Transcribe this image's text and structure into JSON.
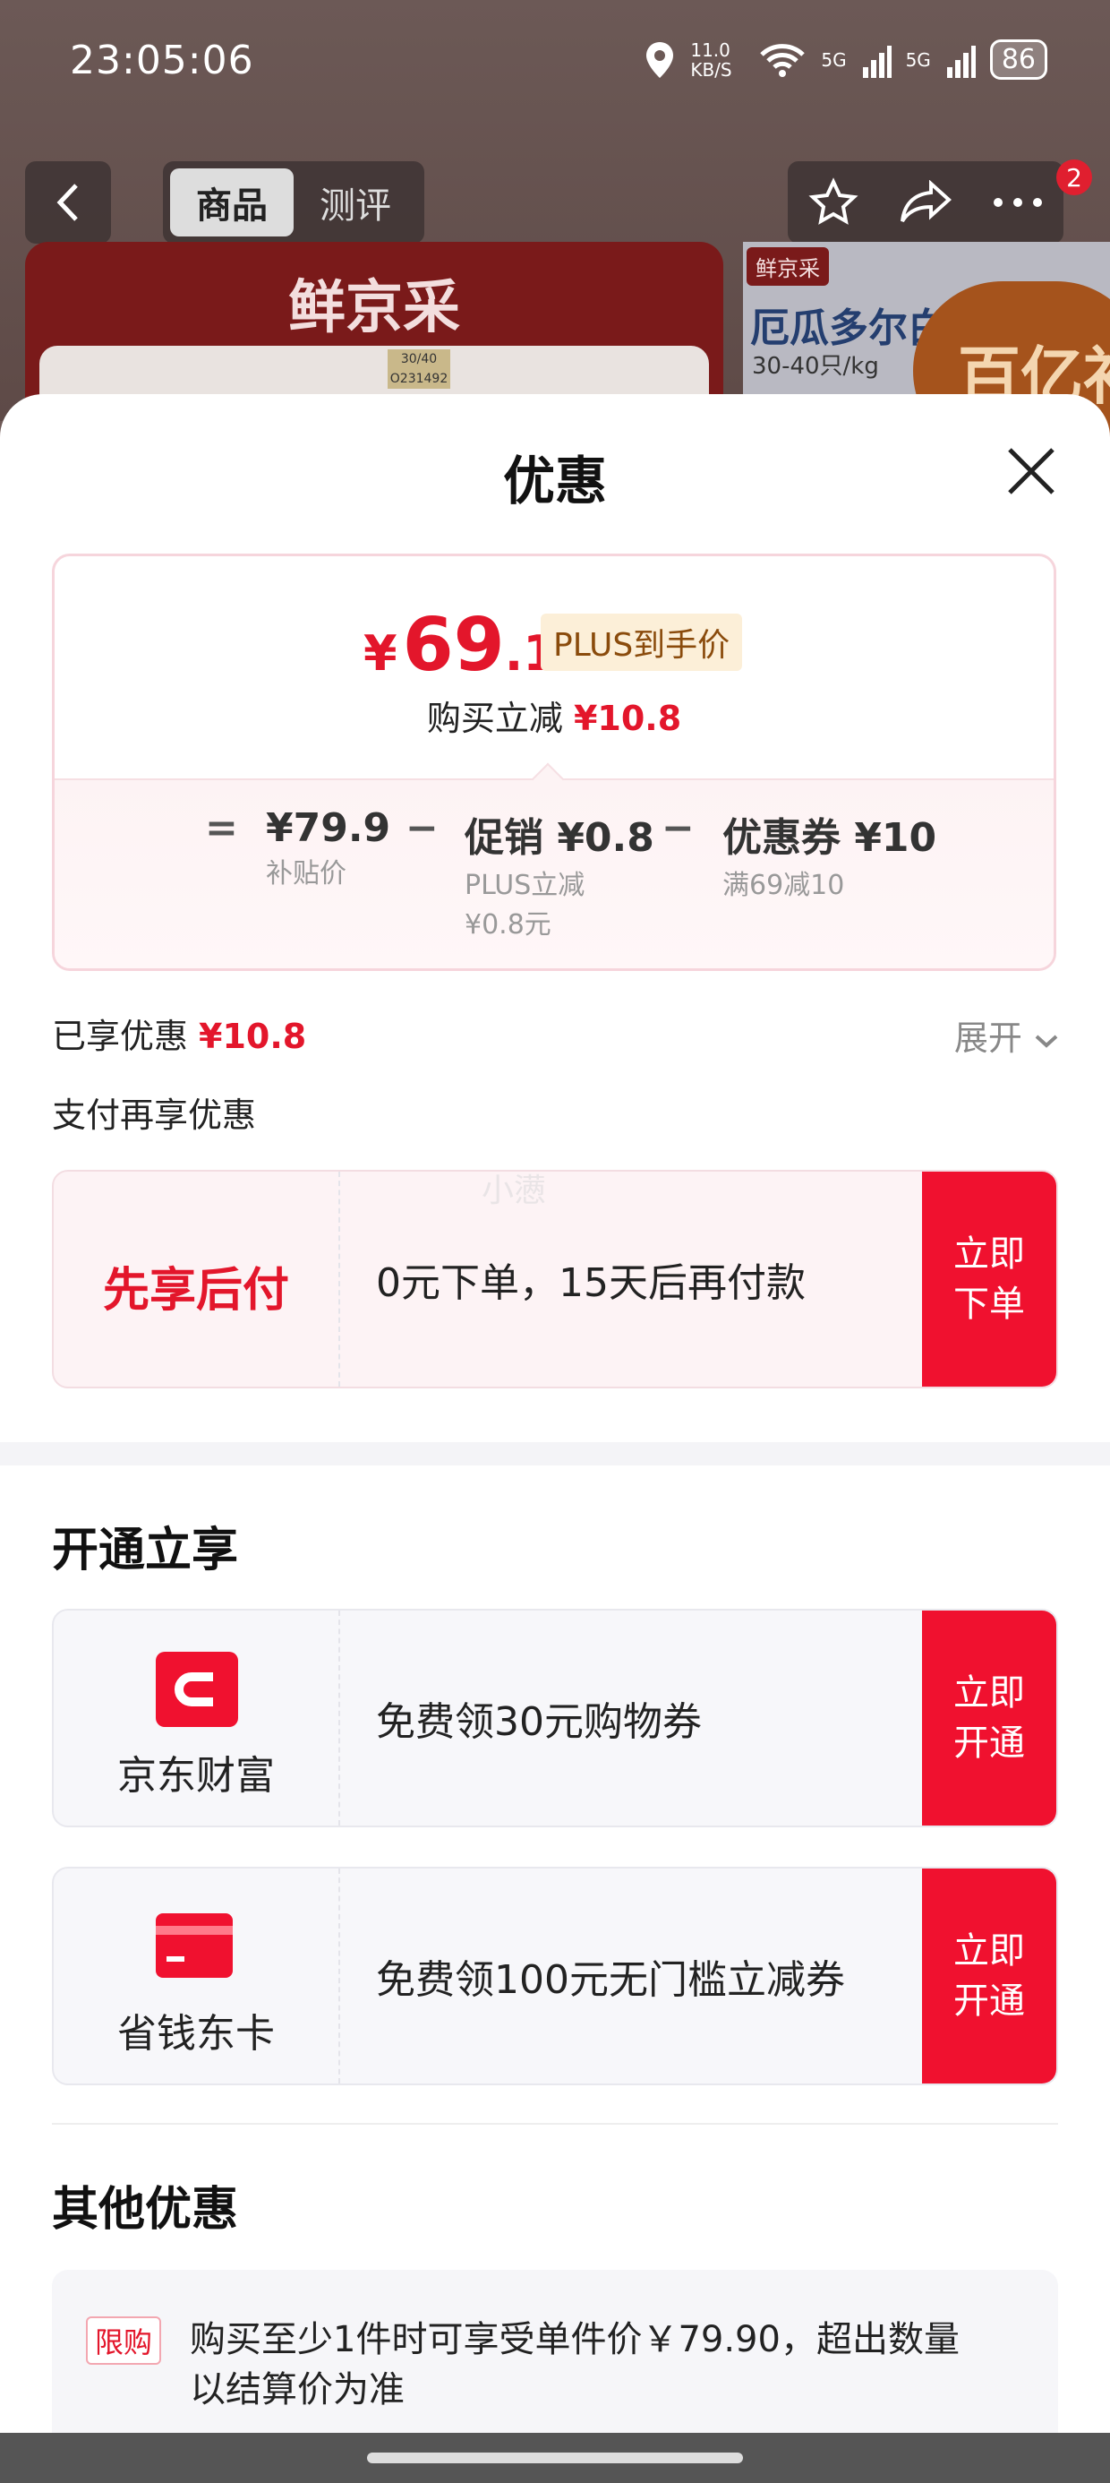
{
  "status_bar": {
    "time": "23:05:06",
    "net_speed": "11.0 KB/S",
    "signal1": "5G",
    "signal2": "5G",
    "battery": "86"
  },
  "nav": {
    "tabs": [
      "商品",
      "测评"
    ],
    "active_tab": 0,
    "more_badge": "2"
  },
  "background_product": {
    "brand": "鲜京采",
    "tag_line1": "30/40",
    "tag_line2": "O231492",
    "side_brand": "鲜京采",
    "side_title": "厄瓜多尔白",
    "side_spec": "30-40只/kg",
    "seal_text": "百亿补"
  },
  "sheet": {
    "title": "优惠",
    "price_card": {
      "currency": "¥",
      "price_int": "69",
      "price_dec": ".1",
      "price_tag": "PLUS到手价",
      "instant_label": "购买立减",
      "instant_value": "¥10.8",
      "eq": "=",
      "minus": "−",
      "base_value": "¥79.9",
      "base_label": "补贴价",
      "promo_value": "促销 ¥0.8",
      "promo_label1": "PLUS立减",
      "promo_label2": "¥0.8元",
      "coupon_value": "优惠券 ¥10",
      "coupon_label": "满69减10"
    },
    "saved_label": "已享优惠",
    "saved_value": "¥10.8",
    "expand_label": "展开",
    "pay_again_label": "支付再享优惠",
    "pay_later": {
      "left": "先享后付",
      "desc": "0元下单，15天后再付款",
      "button": "立即\n下单",
      "watermark": "小懑"
    },
    "open_section_title": "开通立享",
    "open_offers": [
      {
        "name": "京东财富",
        "desc": "免费领30元购物券",
        "button": "立即\n开通"
      },
      {
        "name": "省钱东卡",
        "desc": "免费领100元无门槛立减券",
        "button": "立即\n开通"
      }
    ],
    "other_section_title": "其他优惠",
    "other_offer": {
      "tag": "限购",
      "text": "购买至少1件时可享受单件价￥79.90，超出数量以结算价为准"
    }
  },
  "colors": {
    "accent_red": "#e3162b",
    "button_red": "#f0112f"
  }
}
